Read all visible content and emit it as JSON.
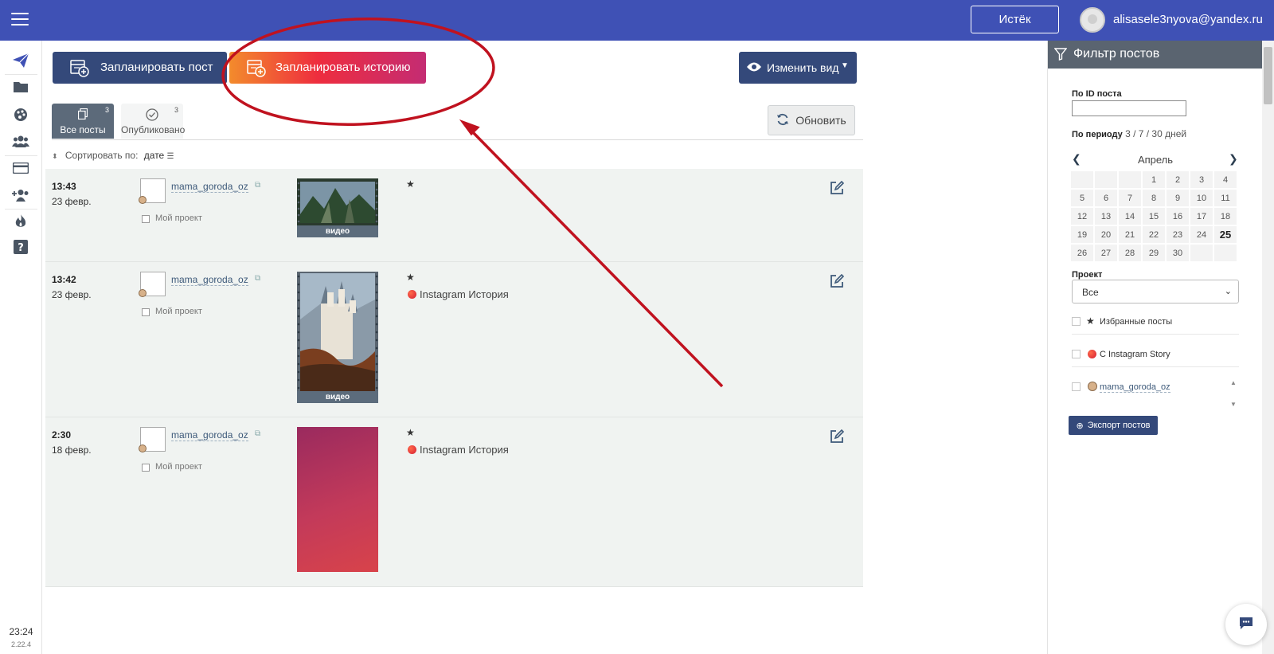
{
  "topbar": {
    "expired_label": "Истёк",
    "user_email": "alisasele3nyova@yandex.ru"
  },
  "sidebar": {
    "items": [
      "send-icon",
      "folder-icon",
      "palette-icon",
      "users-icon",
      "card-icon",
      "add-user-icon",
      "fire-icon",
      "help-icon"
    ],
    "time": "23:24",
    "version": "2.22.4"
  },
  "toolbar": {
    "schedule_post_label": "Запланировать пост",
    "schedule_story_label": "Запланировать историю",
    "change_view_label": "Изменить вид",
    "refresh_label": "Обновить"
  },
  "tabs": [
    {
      "label": "Все посты",
      "count": "3",
      "active": true
    },
    {
      "label": "Опубликовано",
      "count": "3",
      "active": false
    }
  ],
  "sort": {
    "label": "Сортировать по:",
    "value": "дате"
  },
  "posts": [
    {
      "time": "13:43",
      "date": "23 февр.",
      "account": "mama_goroda_oz",
      "project": "Мой проект",
      "star": "★",
      "media_label": "видео",
      "ig_label": ""
    },
    {
      "time": "13:42",
      "date": "23 февр.",
      "account": "mama_goroda_oz",
      "project": "Мой проект",
      "star": "★",
      "media_label": "видео",
      "ig_label": "Instagram История"
    },
    {
      "time": "2:30",
      "date": "18 февр.",
      "account": "mama_goroda_oz",
      "project": "Мой проект",
      "star": "★",
      "media_label": "",
      "ig_label": "Instagram История"
    }
  ],
  "filter": {
    "title": "Фильтр постов",
    "post_id_label": "По ID поста",
    "period_label": "По периоду",
    "period_options": "3 / 7 / 30 дней",
    "month": "Апрель",
    "calendar_days": [
      "",
      "",
      "",
      "1",
      "2",
      "3",
      "4",
      "5",
      "6",
      "7",
      "8",
      "9",
      "10",
      "11",
      "12",
      "13",
      "14",
      "15",
      "16",
      "17",
      "18",
      "19",
      "20",
      "21",
      "22",
      "23",
      "24",
      "25",
      "26",
      "27",
      "28",
      "29",
      "30",
      "",
      ""
    ],
    "today": "25",
    "project_label": "Проект",
    "project_value": "Все",
    "favorites_label": "Избранные посты",
    "ig_story_label": "С Instagram Story",
    "account_label": "mama_goroda_oz",
    "export_label": "Экспорт постов"
  },
  "colors": {
    "topbar": "#3f51b5",
    "primary_button": "#34497a",
    "annotation": "#c0121f"
  }
}
